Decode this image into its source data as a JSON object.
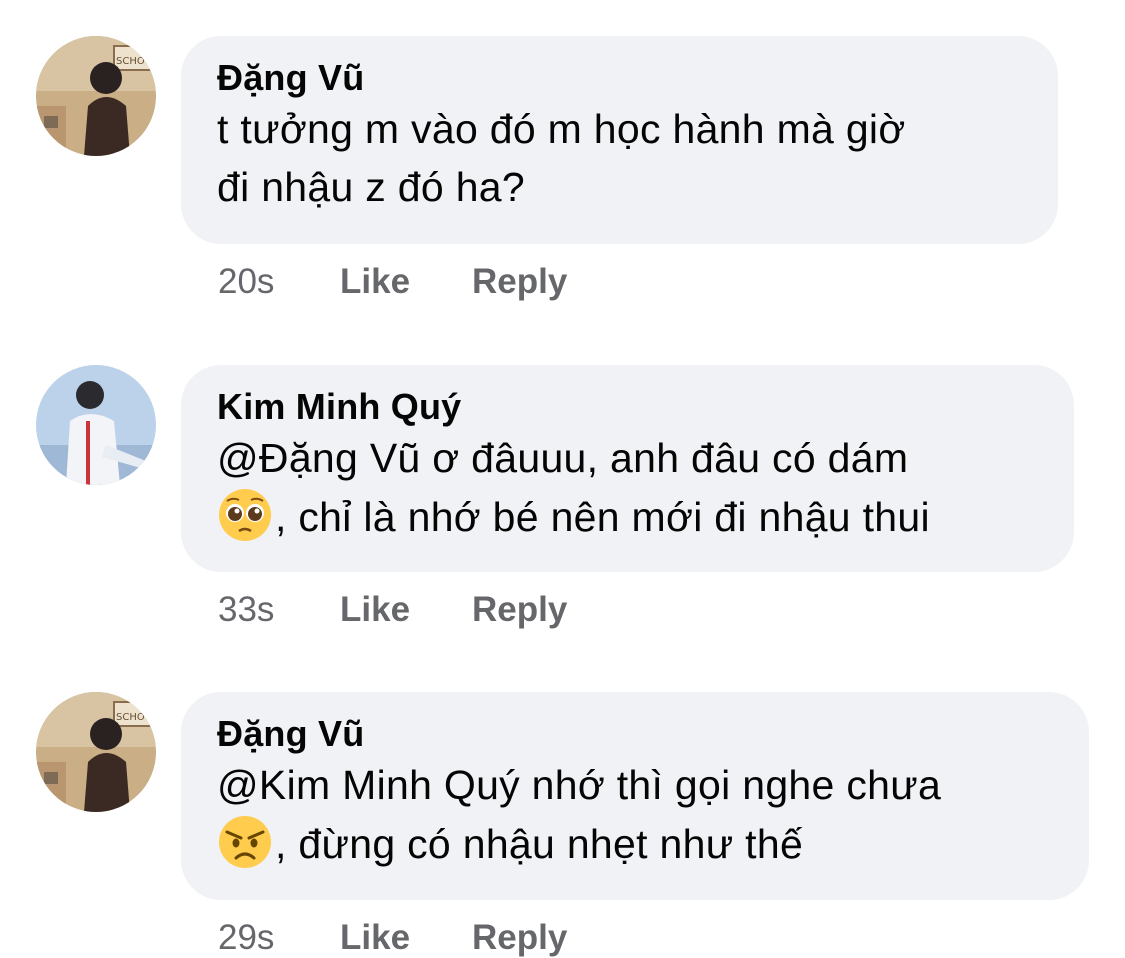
{
  "comments": [
    {
      "author": "Đặng Vũ",
      "lines": [
        "t tưởng m vào đó m học hành mà giờ",
        "đi nhậu z đó ha?"
      ],
      "emoji": null,
      "time": "20s",
      "like_label": "Like",
      "reply_label": "Reply"
    },
    {
      "author": "Kim Minh Quý",
      "lines": [
        "@Đặng Vũ ơ đâuuu, anh đâu có dám",
        ", chỉ là nhớ bé nên mới đi nhậu thui"
      ],
      "emoji": "pleading-face",
      "time": "33s",
      "like_label": "Like",
      "reply_label": "Reply"
    },
    {
      "author": "Đặng Vũ",
      "lines": [
        "@Kim Minh Quý nhớ thì gọi nghe chưa",
        ", đừng có nhậu nhẹt như thế"
      ],
      "emoji": "angry-face",
      "time": "29s",
      "like_label": "Like",
      "reply_label": "Reply"
    }
  ],
  "colors": {
    "bubble": "#f0f2f5",
    "meta": "#65676b",
    "text": "#050505"
  }
}
